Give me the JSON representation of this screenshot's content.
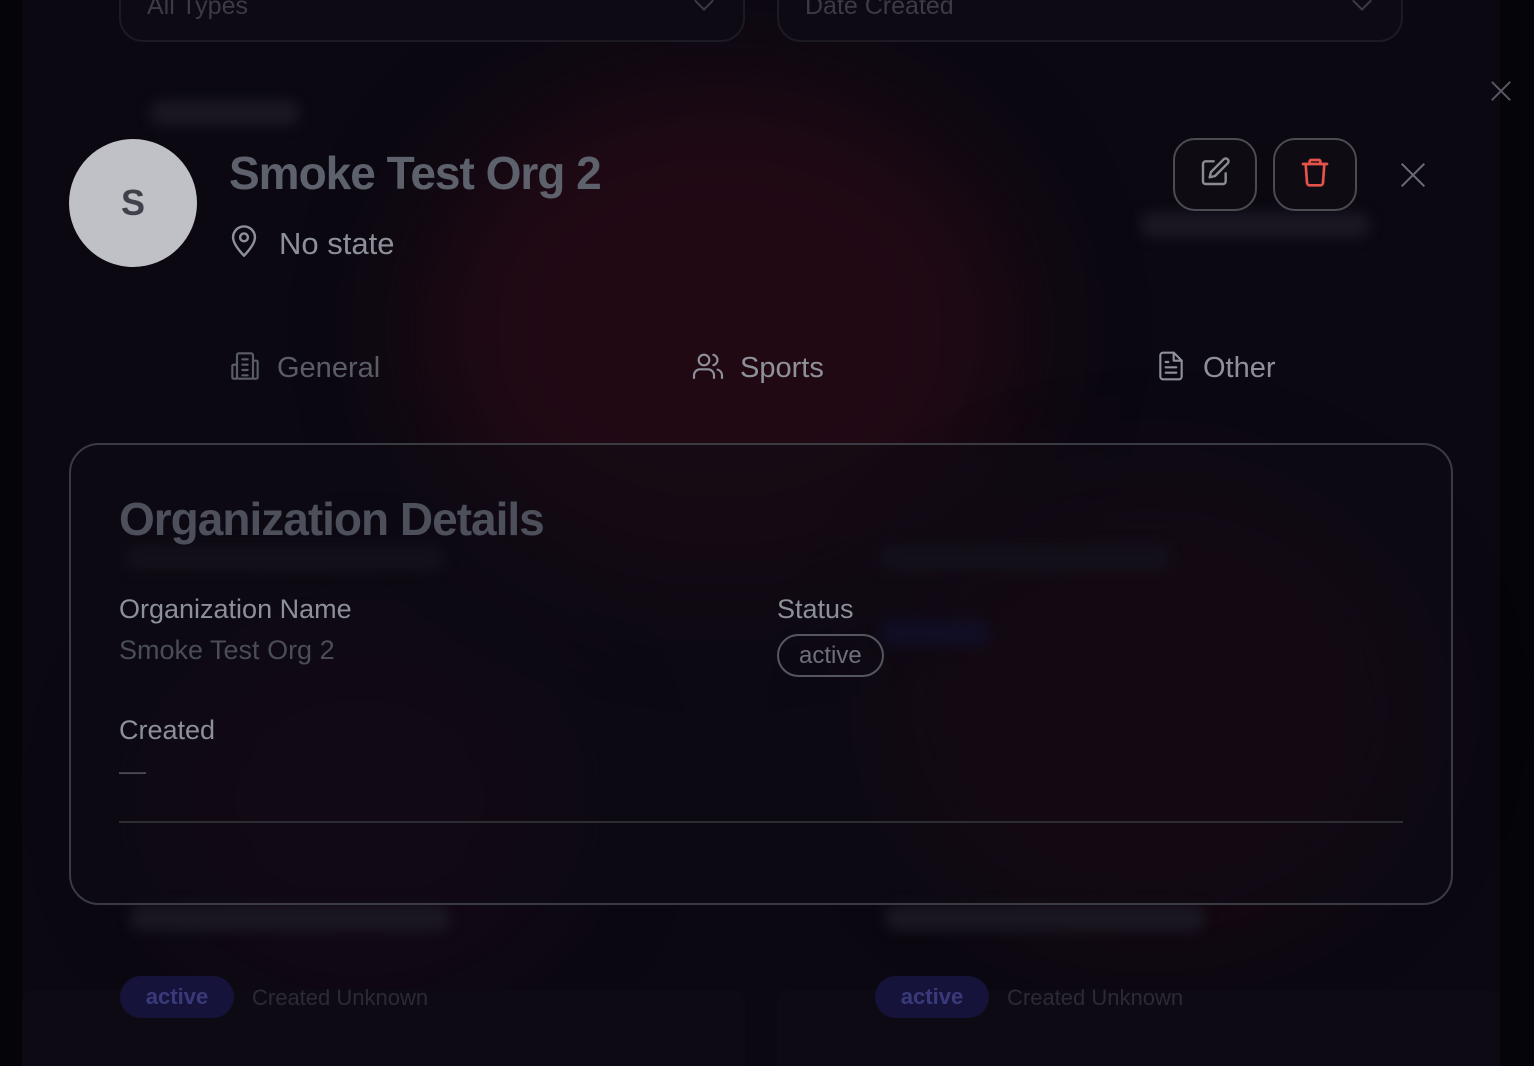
{
  "background": {
    "filters": {
      "type_select": "All Types",
      "sort_select": "Date Created"
    },
    "cards": [
      {
        "status": "active",
        "meta": "Created Unknown"
      },
      {
        "status": "active",
        "meta": "Created Unknown"
      }
    ]
  },
  "header": {
    "avatar_initial": "S",
    "title": "Smoke Test Org 2",
    "location": "No state"
  },
  "tabs": [
    {
      "label": "General",
      "icon": "building-icon"
    },
    {
      "label": "Sports",
      "icon": "users-icon"
    },
    {
      "label": "Other",
      "icon": "document-icon"
    }
  ],
  "details": {
    "title": "Organization Details",
    "fields": {
      "name_label": "Organization Name",
      "name_value": "Smoke Test Org 2",
      "status_label": "Status",
      "status_value": "active",
      "created_label": "Created",
      "created_value": "—"
    }
  },
  "colors": {
    "delete_accent": "#e5534b",
    "backdrop": "#050409"
  }
}
